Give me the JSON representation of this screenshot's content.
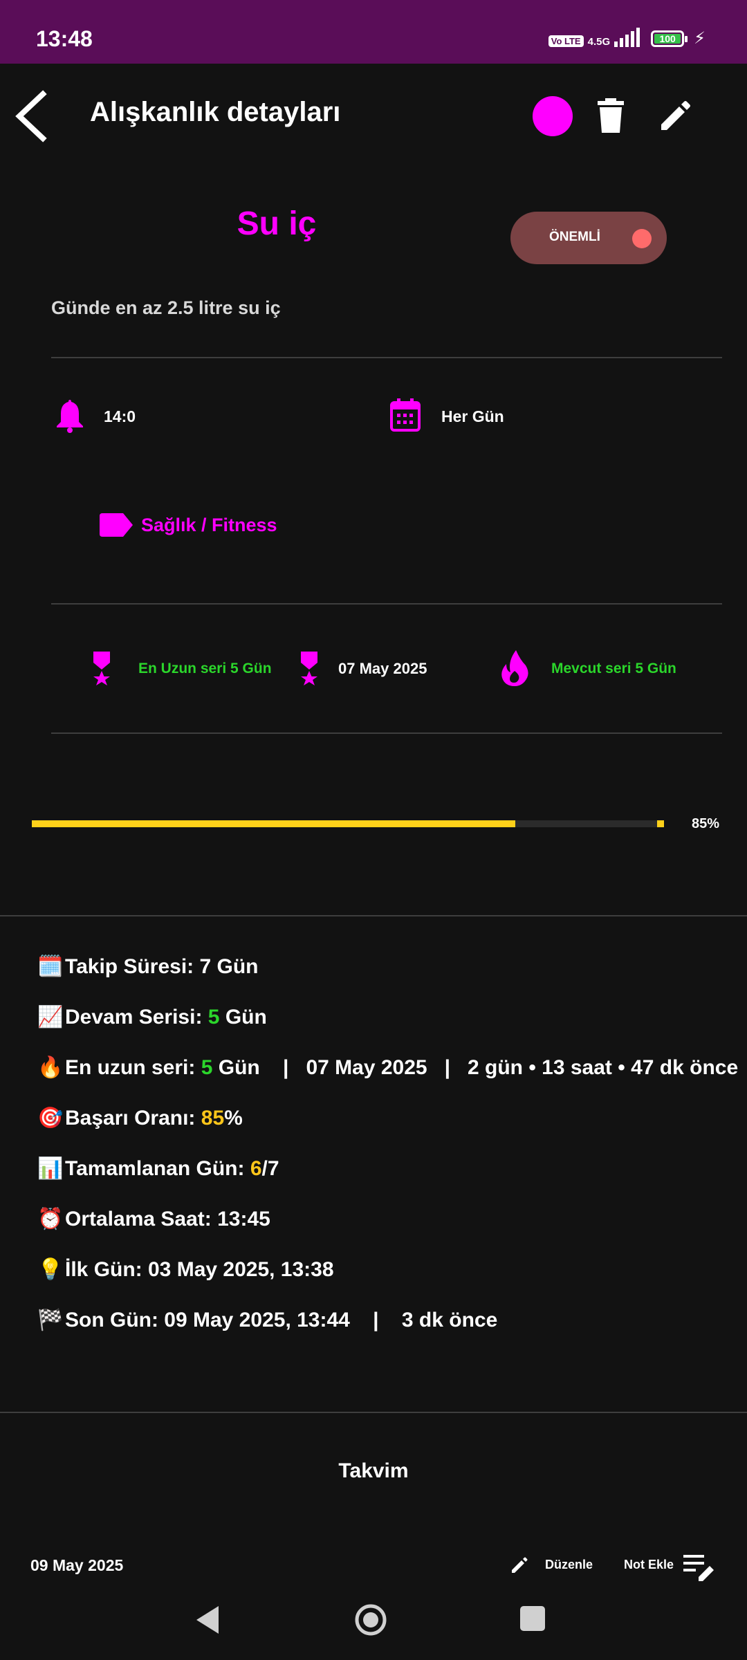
{
  "status_bar": {
    "time": "13:48",
    "volte": "Vo LTE",
    "network": "4.5G",
    "battery": "100"
  },
  "app_bar": {
    "title": "Alışkanlık detayları"
  },
  "habit": {
    "name": "Su iç",
    "important_label": "ÖNEMLİ",
    "description": "Günde en az 2.5 litre su iç",
    "reminder_time": "14:0",
    "frequency": "Her Gün",
    "category": "Sağlık / Fitness"
  },
  "streak_row": {
    "longest": "En Uzun seri 5 Gün",
    "longest_date": "07 May 2025",
    "current": "Mevcut seri 5 Gün"
  },
  "progress": {
    "percent_label": "85%",
    "value": 0.85
  },
  "stats": {
    "tracking_label": "Takip Süresi: 7 Gün",
    "continue_label": "Devam Serisi:",
    "continue_value": "5",
    "continue_unit": "Gün",
    "longest_label": "En uzun seri:",
    "longest_value": "5",
    "longest_rest": "Gün    |   07 May 2025   |   2 gün • 13 saat • 47 dk önce",
    "success_label": "Başarı Oranı:",
    "success_value": "85",
    "success_unit": "%",
    "completed_label": "Tamamlanan Gün:",
    "completed_value": "6",
    "completed_total": "/7",
    "avg_time": "Ortalama Saat: 13:45",
    "first_day": "İlk Gün: 03 May 2025, 13:38",
    "last_day": "Son Gün: 09 May 2025, 13:44    |    3 dk önce"
  },
  "calendar": {
    "title": "Takvim",
    "selected_date": "09 May 2025",
    "edit_label": "Düzenle",
    "add_note_label": "Not Ekle"
  },
  "icons": {
    "tracking": "calendar-emoji",
    "streak": "chart-emoji",
    "longest": "fire-emoji",
    "success": "target-emoji",
    "completed": "bar-chart-emoji",
    "avg": "alarm-clock-emoji",
    "first": "light-bulb-emoji",
    "last": "checkered-flag-emoji"
  },
  "colors": {
    "accent": "#ff00ff",
    "status_bar": "#5a0d58",
    "green": "#2bd62b",
    "yellow": "#ffd11a",
    "background": "#121212"
  }
}
